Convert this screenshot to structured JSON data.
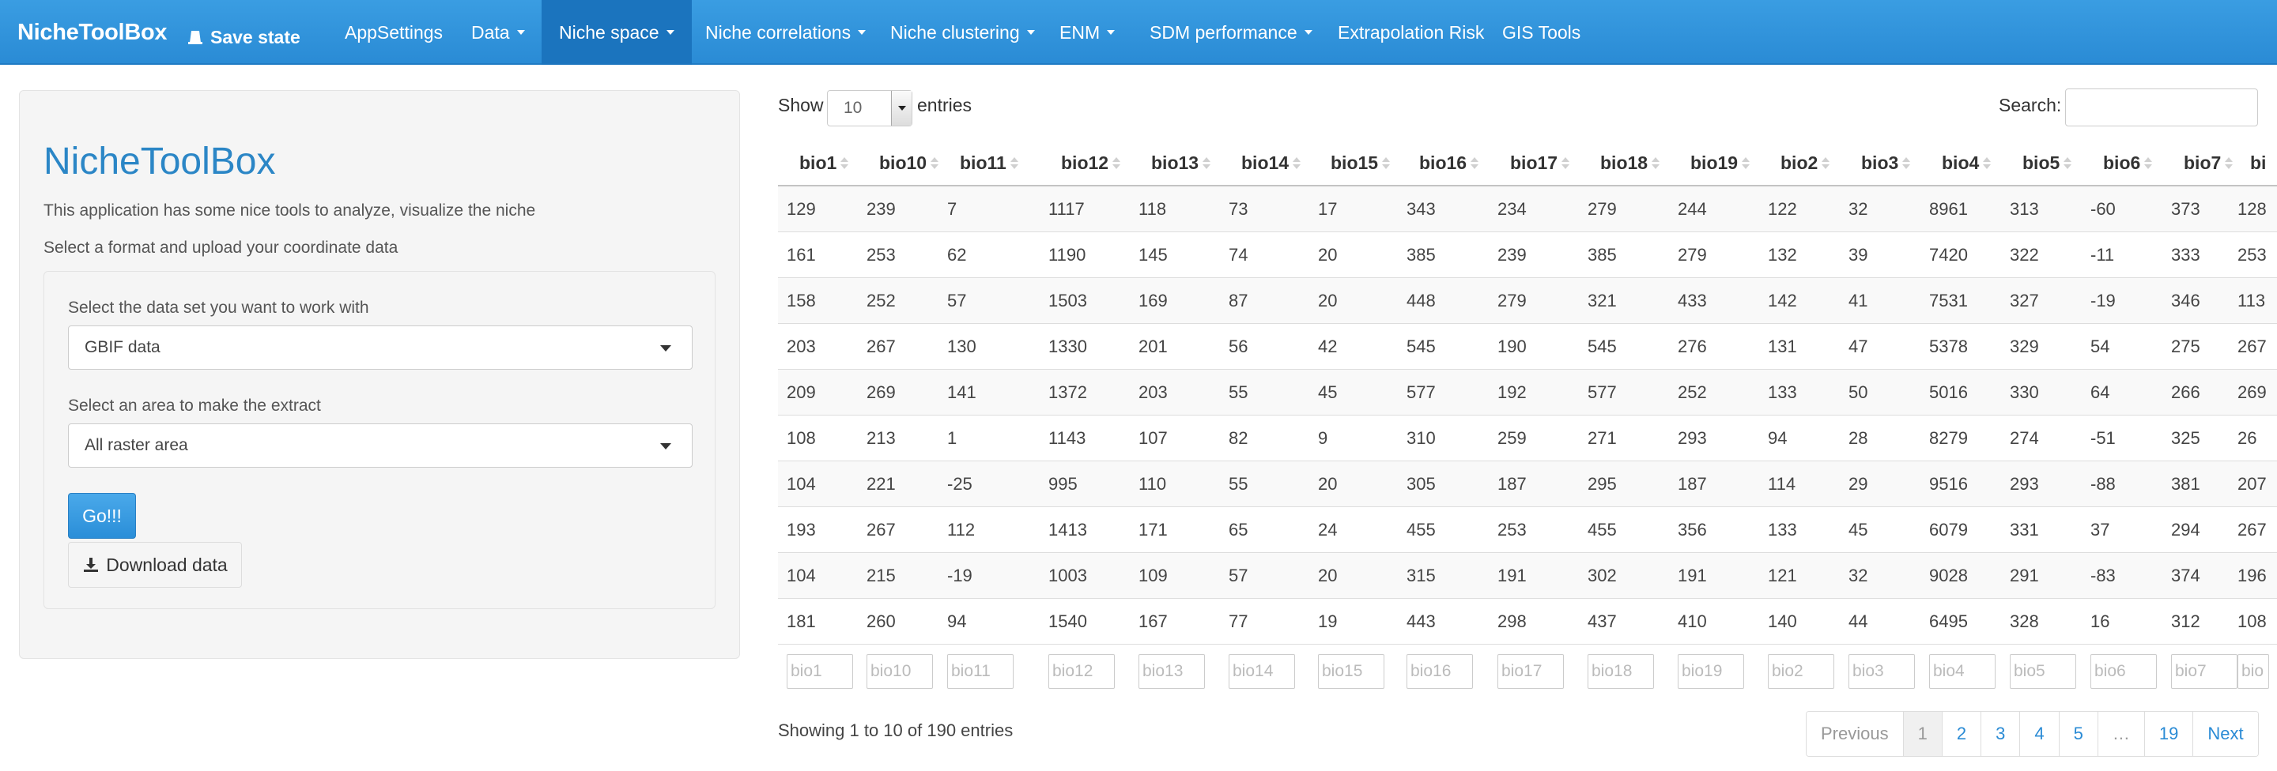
{
  "navbar": {
    "brand": "NicheToolBox",
    "save_state": "Save state",
    "items": [
      {
        "label": "AppSettings",
        "dropdown": false
      },
      {
        "label": "Data",
        "dropdown": true
      },
      {
        "label": "Niche space",
        "dropdown": true,
        "active": true
      },
      {
        "label": "Niche correlations",
        "dropdown": true
      },
      {
        "label": "Niche clustering",
        "dropdown": true
      },
      {
        "label": "ENM",
        "dropdown": true
      },
      {
        "label": "SDM performance",
        "dropdown": true
      },
      {
        "label": "Extrapolation Risk",
        "dropdown": false
      },
      {
        "label": "GIS Tools",
        "dropdown": false
      }
    ]
  },
  "sidebar": {
    "title": "NicheToolBox",
    "description": "This application has some nice tools to analyze, visualize the niche",
    "hint": "Select a format and upload your coordinate data",
    "dataset_label": "Select the data set you want to work with",
    "dataset_value": "GBIF data",
    "area_label": "Select an area to make the extract",
    "area_value": "All raster area",
    "go_button": "Go!!!",
    "download_button": "Download data"
  },
  "table": {
    "show_label": "Show",
    "length_value": "10",
    "entries_label": "entries",
    "search_label": "Search:",
    "columns": [
      "bio1",
      "bio10",
      "bio11",
      "bio12",
      "bio13",
      "bio14",
      "bio15",
      "bio16",
      "bio17",
      "bio18",
      "bio19",
      "bio2",
      "bio3",
      "bio4",
      "bio5",
      "bio6",
      "bio7",
      "bi"
    ],
    "rows": [
      [
        "129",
        "239",
        "7",
        "1117",
        "118",
        "73",
        "17",
        "343",
        "234",
        "279",
        "244",
        "122",
        "32",
        "8961",
        "313",
        "-60",
        "373",
        "128"
      ],
      [
        "161",
        "253",
        "62",
        "1190",
        "145",
        "74",
        "20",
        "385",
        "239",
        "385",
        "279",
        "132",
        "39",
        "7420",
        "322",
        "-11",
        "333",
        "253"
      ],
      [
        "158",
        "252",
        "57",
        "1503",
        "169",
        "87",
        "20",
        "448",
        "279",
        "321",
        "433",
        "142",
        "41",
        "7531",
        "327",
        "-19",
        "346",
        "113"
      ],
      [
        "203",
        "267",
        "130",
        "1330",
        "201",
        "56",
        "42",
        "545",
        "190",
        "545",
        "276",
        "131",
        "47",
        "5378",
        "329",
        "54",
        "275",
        "267"
      ],
      [
        "209",
        "269",
        "141",
        "1372",
        "203",
        "55",
        "45",
        "577",
        "192",
        "577",
        "252",
        "133",
        "50",
        "5016",
        "330",
        "64",
        "266",
        "269"
      ],
      [
        "108",
        "213",
        "1",
        "1143",
        "107",
        "82",
        "9",
        "310",
        "259",
        "271",
        "293",
        "94",
        "28",
        "8279",
        "274",
        "-51",
        "325",
        "26"
      ],
      [
        "104",
        "221",
        "-25",
        "995",
        "110",
        "55",
        "20",
        "305",
        "187",
        "295",
        "187",
        "114",
        "29",
        "9516",
        "293",
        "-88",
        "381",
        "207"
      ],
      [
        "193",
        "267",
        "112",
        "1413",
        "171",
        "65",
        "24",
        "455",
        "253",
        "455",
        "356",
        "133",
        "45",
        "6079",
        "331",
        "37",
        "294",
        "267"
      ],
      [
        "104",
        "215",
        "-19",
        "1003",
        "109",
        "57",
        "20",
        "315",
        "191",
        "302",
        "191",
        "121",
        "32",
        "9028",
        "291",
        "-83",
        "374",
        "196"
      ],
      [
        "181",
        "260",
        "94",
        "1540",
        "167",
        "77",
        "19",
        "443",
        "298",
        "437",
        "410",
        "140",
        "44",
        "6495",
        "328",
        "16",
        "312",
        "108"
      ]
    ],
    "filter_placeholders": [
      "bio1",
      "bio10",
      "bio11",
      "bio12",
      "bio13",
      "bio14",
      "bio15",
      "bio16",
      "bio17",
      "bio18",
      "bio19",
      "bio2",
      "bio3",
      "bio4",
      "bio5",
      "bio6",
      "bio7",
      "bio"
    ],
    "info": "Showing 1 to 10 of 190 entries",
    "pagination": [
      "Previous",
      "1",
      "2",
      "3",
      "4",
      "5",
      "…",
      "19",
      "Next"
    ]
  }
}
